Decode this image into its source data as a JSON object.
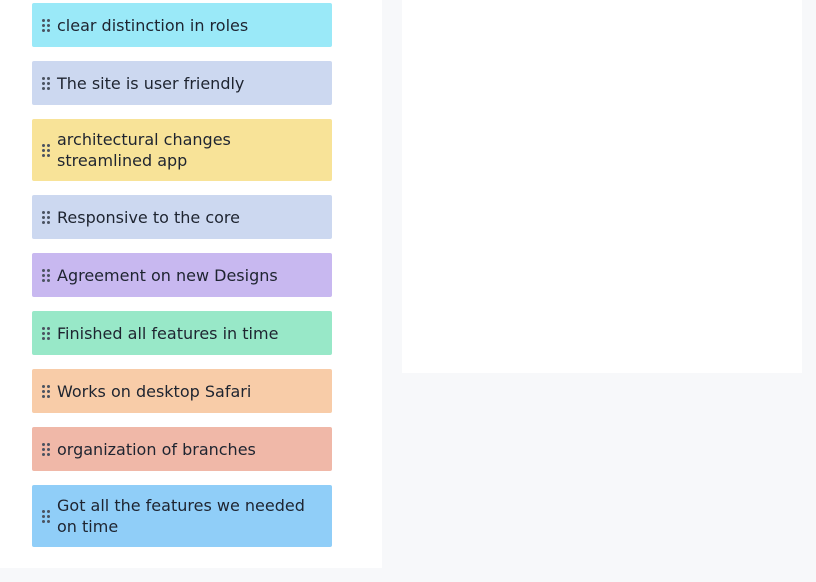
{
  "cards": [
    {
      "label": "clear distinction in roles",
      "color": "#9ae9f8"
    },
    {
      "label": "The site is user friendly",
      "color": "#ccd8f0"
    },
    {
      "label": "architectural changes streamlined app",
      "color": "#f8e398"
    },
    {
      "label": "Responsive to the core",
      "color": "#ccd8f0"
    },
    {
      "label": "Agreement on new Designs",
      "color": "#c8b8f0"
    },
    {
      "label": "Finished all features in time",
      "color": "#98e8c8"
    },
    {
      "label": "Works on desktop Safari",
      "color": "#f8cca8"
    },
    {
      "label": "organization of branches",
      "color": "#f0b8a8"
    },
    {
      "label": "Got all the features we needed on time",
      "color": "#90cef8"
    }
  ],
  "icons": {
    "drag_handle": "drag-handle-icon"
  }
}
